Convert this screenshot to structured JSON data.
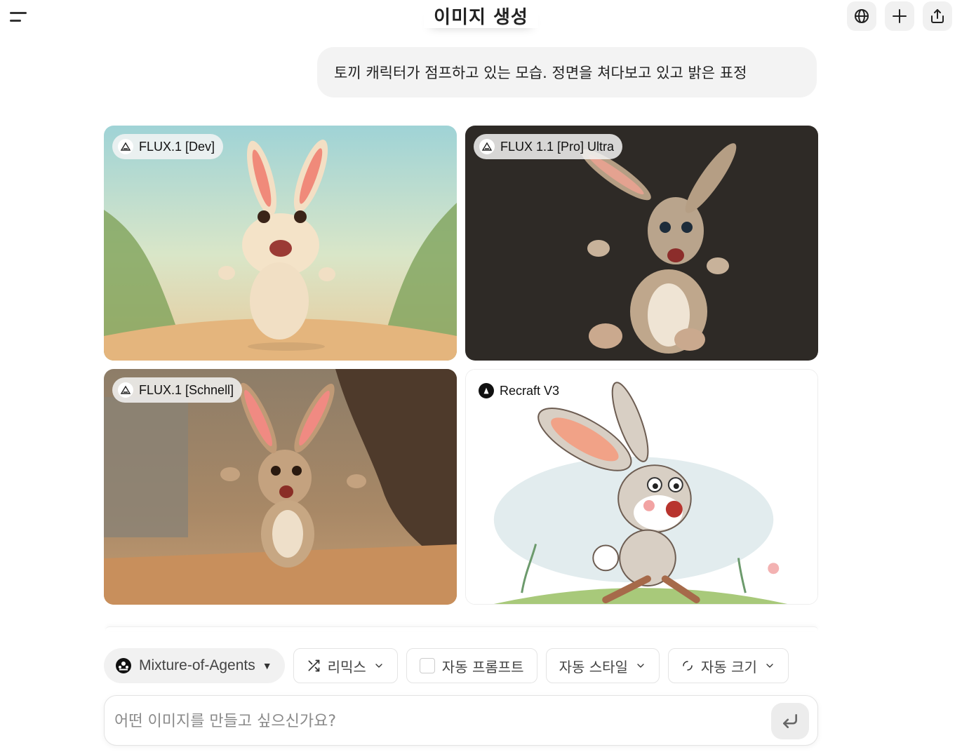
{
  "header": {
    "title": "이미지 생성",
    "icons": [
      "menu-icon",
      "globe-icon",
      "plus-icon",
      "share-icon"
    ]
  },
  "prompt": {
    "text": "토끼 캐릭터가 점프하고 있는 모습. 정면을 쳐다보고 있고 밝은 표정"
  },
  "results": [
    {
      "model": "FLUX.1 [Dev]",
      "icon": "flux-icon"
    },
    {
      "model": "FLUX 1.1 [Pro] Ultra",
      "icon": "flux-icon"
    },
    {
      "model": "FLUX.1 [Schnell]",
      "icon": "flux-icon"
    },
    {
      "model": "Recraft V3",
      "icon": "recraft-icon"
    }
  ],
  "toolbar": {
    "model_selector": "Mixture-of-Agents",
    "remix": "리믹스",
    "auto_prompt": "자동 프롬프트",
    "auto_style": "자동 스타일",
    "auto_size": "자동 크기"
  },
  "composer": {
    "placeholder": "어떤 이미지를 만들고 싶으신가요?"
  }
}
